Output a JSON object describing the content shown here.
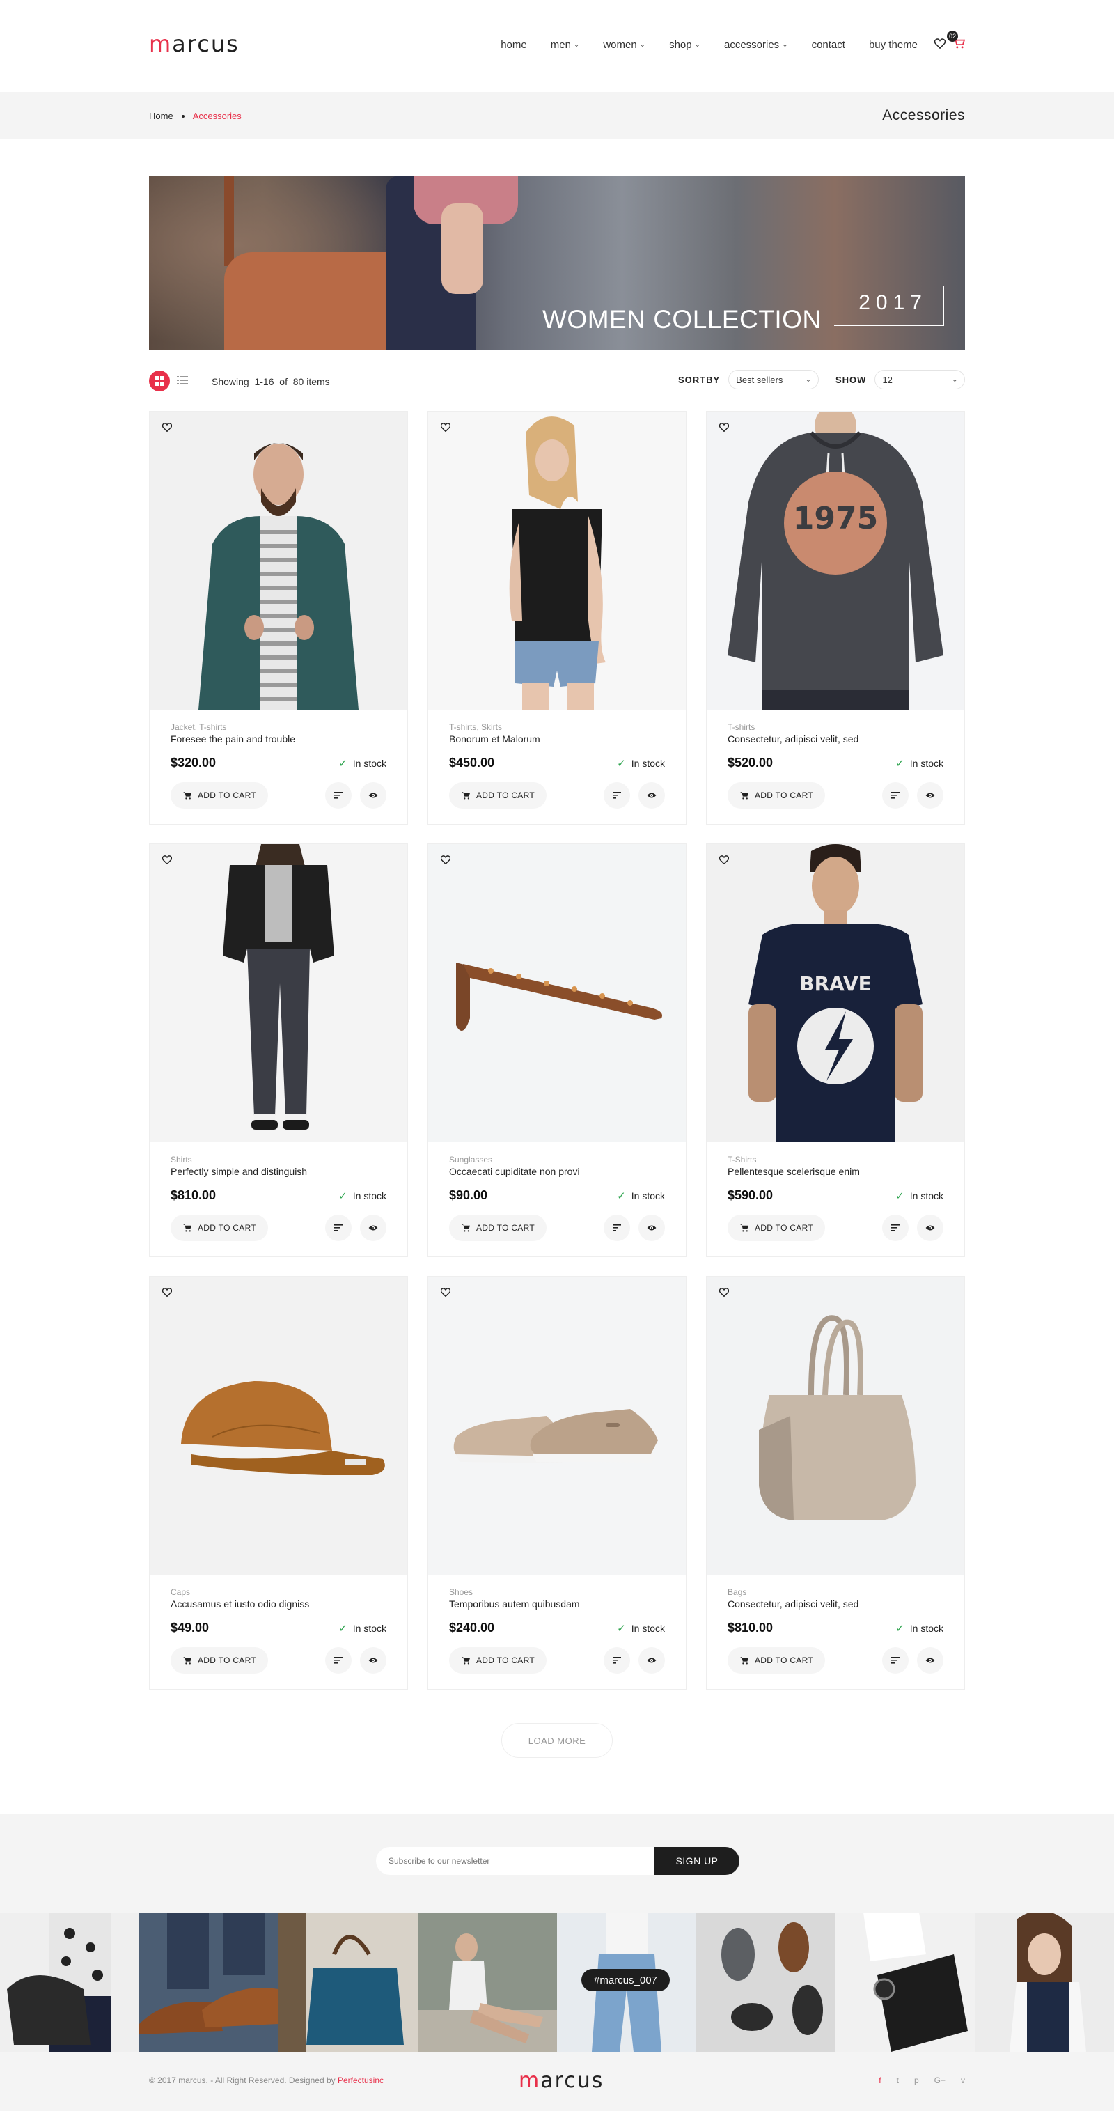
{
  "header": {
    "logo_first": "m",
    "logo_rest": "arcus",
    "nav": [
      {
        "label": "home",
        "dropdown": false
      },
      {
        "label": "men",
        "dropdown": true
      },
      {
        "label": "women",
        "dropdown": true
      },
      {
        "label": "shop",
        "dropdown": true
      },
      {
        "label": "accessories",
        "dropdown": true
      },
      {
        "label": "contact",
        "dropdown": false
      },
      {
        "label": "buy theme",
        "dropdown": false
      }
    ],
    "cart_count": "02"
  },
  "breadcrumb": {
    "home": "Home",
    "current": "Accessories",
    "title": "Accessories"
  },
  "banner": {
    "headline": "WOMEN COLLECTION",
    "year": "2017"
  },
  "toolbar": {
    "showing_prefix": "Showing",
    "showing_range": "1-16",
    "showing_of": "of",
    "showing_total": "80 items",
    "sortby_label": "SORTBY",
    "sortby_value": "Best sellers",
    "show_label": "SHOW",
    "show_value": "12"
  },
  "product_actions": {
    "add_to_cart": "ADD TO CART",
    "in_stock": "In stock"
  },
  "products": [
    {
      "category": "Jacket, T-shirts",
      "name": "Foresee the pain and trouble",
      "price": "$320.00"
    },
    {
      "category": "T-shirts, Skirts",
      "name": "Bonorum et Malorum",
      "price": "$450.00"
    },
    {
      "category": "T-shirts",
      "name": "Consectetur, adipisci velit, sed",
      "price": "$520.00"
    },
    {
      "category": "Shirts",
      "name": "Perfectly simple and distinguish",
      "price": "$810.00"
    },
    {
      "category": "Sunglasses",
      "name": "Occaecati cupiditate non provi",
      "price": "$90.00"
    },
    {
      "category": "T-Shirts",
      "name": "Pellentesque scelerisque enim",
      "price": "$590.00"
    },
    {
      "category": "Caps",
      "name": "Accusamus et iusto odio digniss",
      "price": "$49.00"
    },
    {
      "category": "Shoes",
      "name": "Temporibus autem quibusdam",
      "price": "$240.00"
    },
    {
      "category": "Bags",
      "name": "Consectetur, adipisci velit, sed",
      "price": "$810.00"
    }
  ],
  "load_more": "LOAD MORE",
  "newsletter": {
    "placeholder": "Subscribe to our newsletter",
    "button": "SIGN UP"
  },
  "instagram": {
    "tag": "#marcus_007"
  },
  "footer": {
    "copyright": "© 2017 marcus.  -  All Right Reserved. Designed by",
    "designer": "Perfectusinc",
    "logo_first": "m",
    "logo_rest": "arcus",
    "social": [
      "f",
      "t",
      "p",
      "G+",
      "v"
    ]
  },
  "colors": {
    "accent": "#e8304a",
    "dark": "#1e1e1e",
    "light_bg": "#f4f4f4",
    "stock_green": "#2ea44f"
  }
}
